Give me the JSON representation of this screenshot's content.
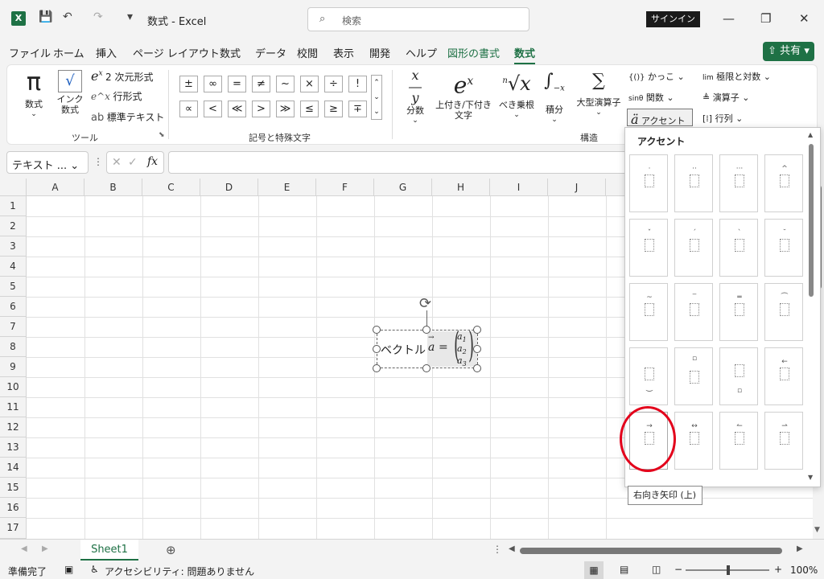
{
  "titlebar": {
    "app_title": "数式  -  Excel",
    "search_placeholder": "検索",
    "signin_label": "サインイン"
  },
  "menu": {
    "items": [
      "ファイル",
      "ホーム",
      "挿入",
      "ページ レイアウト",
      "数式",
      "データ",
      "校閲",
      "表示",
      "開発",
      "ヘルプ",
      "図形の書式",
      "数式"
    ],
    "share_label": "共有"
  },
  "ribbon": {
    "tools": {
      "equation": "数式",
      "ink": "インク\n数式",
      "professional": "2 次元形式",
      "linear": "行形式",
      "normal_text": "標準テキスト",
      "group_label": "ツール"
    },
    "symbols": {
      "row1": [
        "±",
        "∞",
        "=",
        "≠",
        "~",
        "×",
        "÷",
        "!"
      ],
      "row2": [
        "∝",
        "<",
        "≪",
        ">",
        "≫",
        "≤",
        "≥",
        "∓"
      ],
      "group_label": "記号と特殊文字"
    },
    "structures": {
      "fraction": "分数",
      "script": "上付き/下付き\n文字",
      "radical": "べき乗根",
      "integral": "積分",
      "large_operator": "大型演算子",
      "bracket": "かっこ",
      "function": "関数",
      "accent": "アクセント",
      "limit": "極限と対数",
      "operator": "演算子",
      "matrix": "行列",
      "group_label": "構造"
    }
  },
  "formula_bar": {
    "name_box": "テキスト ...",
    "fx_label": "fx"
  },
  "grid": {
    "columns": [
      "A",
      "B",
      "C",
      "D",
      "E",
      "F",
      "G",
      "H",
      "I",
      "J"
    ],
    "rows": [
      "1",
      "2",
      "3",
      "4",
      "5",
      "6",
      "7",
      "8",
      "9",
      "10",
      "11",
      "12",
      "13",
      "14",
      "15",
      "16",
      "17"
    ]
  },
  "equation": {
    "prefix_text": "ベクトル",
    "vector_symbol": "a",
    "equals": "=",
    "entries": [
      "a",
      "a",
      "a"
    ],
    "subscripts": [
      "1",
      "2",
      "3"
    ]
  },
  "gallery": {
    "title": "アクセント",
    "tooltip": "右向き矢印 (上)"
  },
  "sheet_tabs": [
    "Sheet1"
  ],
  "status": {
    "ready": "準備完了",
    "accessibility": "アクセシビリティ: 問題ありません",
    "zoom": "100%"
  }
}
